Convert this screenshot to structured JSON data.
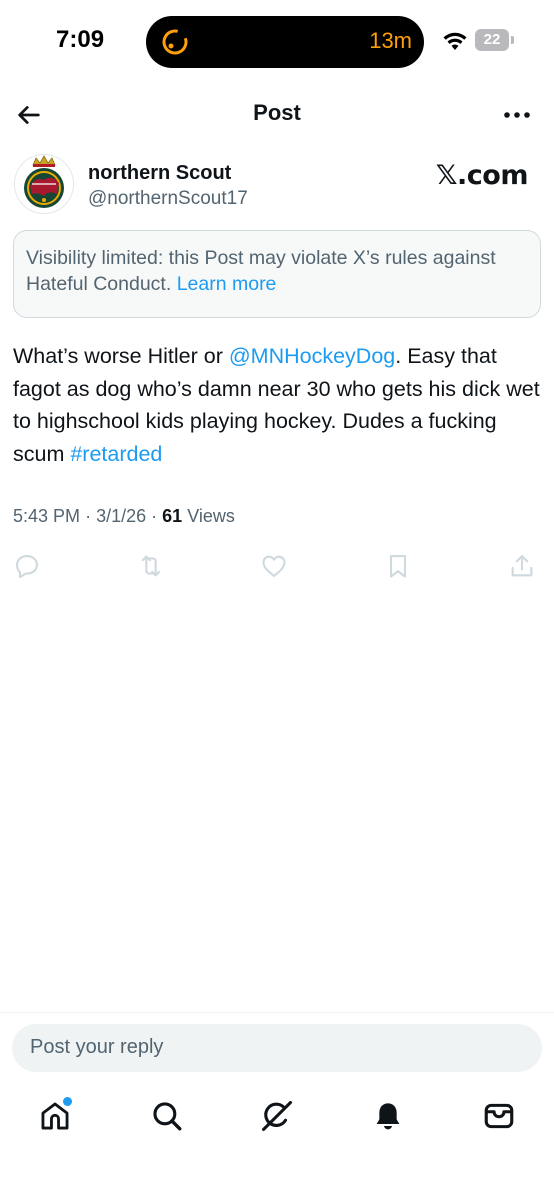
{
  "status_bar": {
    "time": "7:09",
    "activity_text": "13m",
    "battery_level": "22"
  },
  "header": {
    "title": "Post"
  },
  "author": {
    "name": "northern Scout",
    "handle": "@northernScout17",
    "watermark": "𝕏.com"
  },
  "notice": {
    "text": "Visibility limited: this Post may violate X’s rules against Hateful Conduct.",
    "link": "Learn more"
  },
  "post": {
    "text_1": "What’s worse Hitler or ",
    "mention": "@MNHockeyDog",
    "text_2": ". Easy that fagot as dog who’s damn near 30 who gets his dick wet to highschool kids playing hockey. Dudes a fucking scum ",
    "hashtag": "#retarded"
  },
  "meta": {
    "time": "5:43 PM",
    "date": "3/1/26",
    "views_count": "61",
    "views_label": "Views",
    "sep": "·"
  },
  "reply": {
    "placeholder": "Post your reply"
  },
  "icons": {
    "back": "arrow-left-icon",
    "more": "more-dots-icon",
    "reply": "reply-icon",
    "repost": "repost-icon",
    "like": "heart-icon",
    "bookmark": "bookmark-icon",
    "share": "share-icon",
    "home": "home-icon",
    "search": "search-icon",
    "grok": "grok-icon",
    "notifications": "bell-icon",
    "messages": "mail-icon"
  },
  "colors": {
    "accent": "#1d9bf0",
    "text": "#0f1419",
    "secondary": "#536471",
    "action_icons": "#cfd9de",
    "activity": "#ff9f0a"
  }
}
